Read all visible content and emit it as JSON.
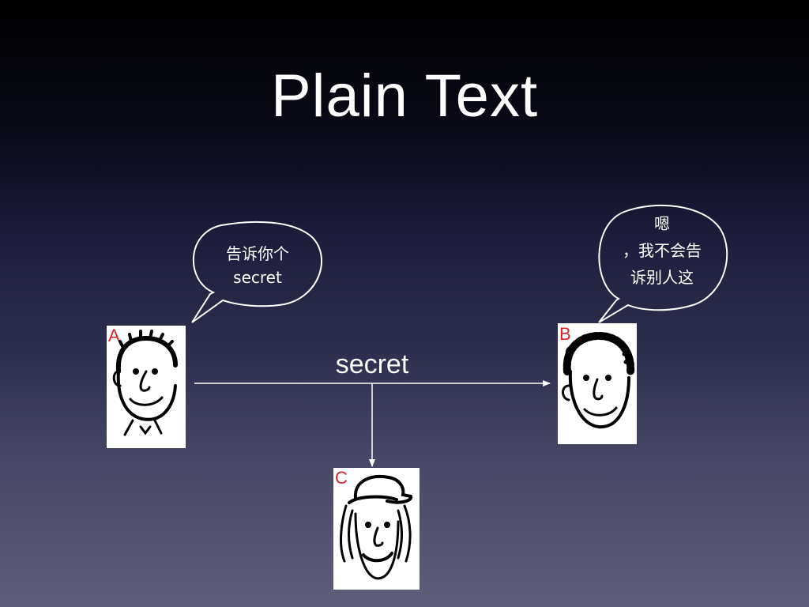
{
  "slide": {
    "title": "Plain Text"
  },
  "persons": {
    "a": {
      "tag": "A"
    },
    "b": {
      "tag": "B"
    },
    "c": {
      "tag": "C"
    }
  },
  "bubbles": {
    "a": {
      "lines": [
        "告诉你个",
        "secret"
      ]
    },
    "b": {
      "lines": [
        "嗯",
        "，我不会告",
        "诉别人这"
      ]
    }
  },
  "message": {
    "label": "secret"
  },
  "colors": {
    "tag": "#d9262c",
    "lines": "#ffffff"
  }
}
